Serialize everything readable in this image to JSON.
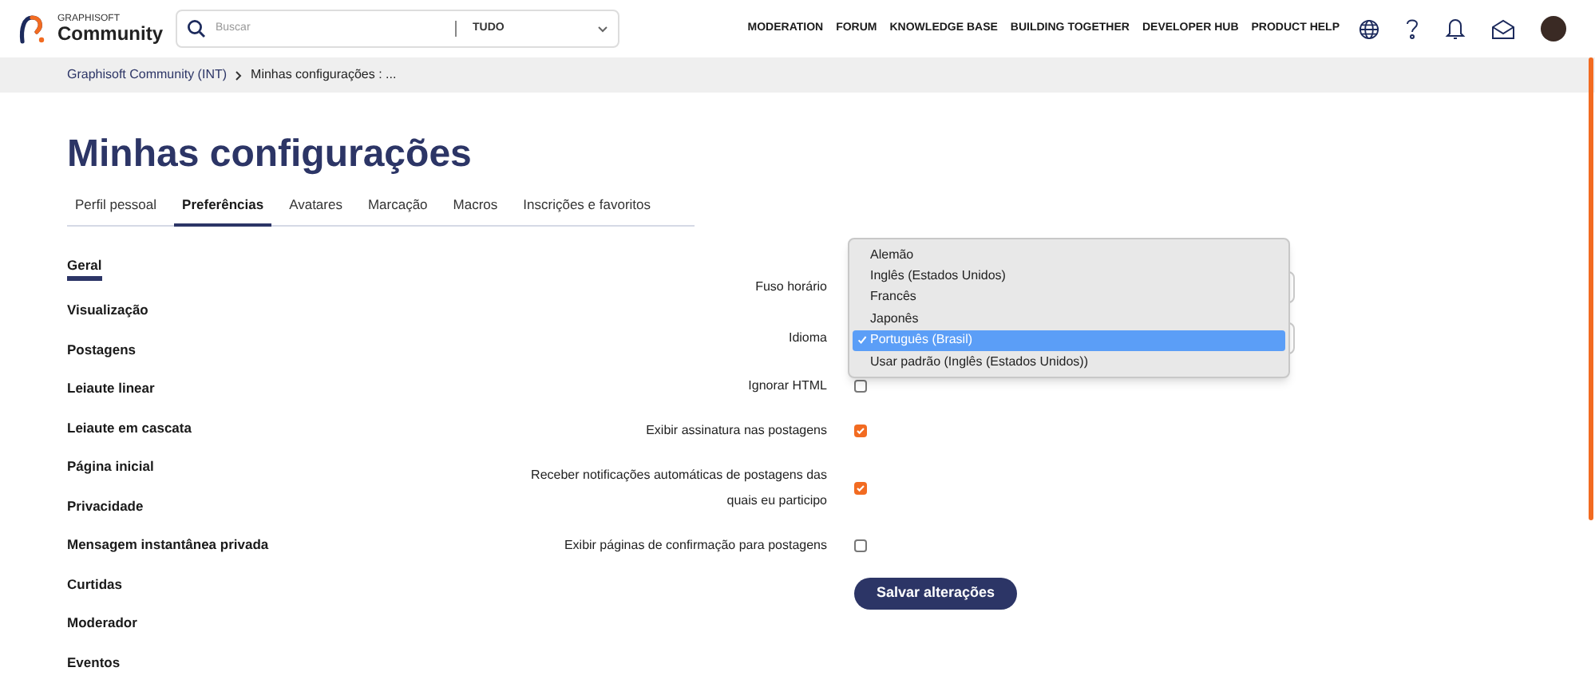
{
  "header": {
    "logo_small": "GRAPHISOFT",
    "logo_big": "Community",
    "search": {
      "placeholder": "Buscar",
      "scope": "TUDO"
    },
    "nav": [
      "MODERATION",
      "FORUM",
      "KNOWLEDGE BASE",
      "BUILDING TOGETHER",
      "DEVELOPER HUB",
      "PRODUCT HELP"
    ]
  },
  "breadcrumb": [
    "Graphisoft Community (INT)",
    "Minhas configurações : ..."
  ],
  "title": "Minhas configurações",
  "tabs": [
    {
      "label": "Perfil pessoal",
      "selected": false
    },
    {
      "label": "Preferências",
      "selected": true
    },
    {
      "label": "Avatares",
      "selected": false
    },
    {
      "label": "Marcação",
      "selected": false
    },
    {
      "label": "Macros",
      "selected": false
    },
    {
      "label": "Inscrições e favoritos",
      "selected": false
    }
  ],
  "sidebar": {
    "items": [
      {
        "label": "Geral",
        "selected": true
      },
      {
        "label": "Visualização",
        "selected": false
      },
      {
        "label": "Postagens",
        "selected": false
      },
      {
        "label": "Leiaute linear",
        "selected": false
      },
      {
        "label": "Leiaute em cascata",
        "selected": false
      },
      {
        "label": "Página inicial",
        "selected": false
      },
      {
        "label": "Privacidade",
        "selected": false
      },
      {
        "label": "Mensagem instantânea privada",
        "selected": false
      },
      {
        "label": "Curtidas",
        "selected": false
      },
      {
        "label": "Moderador",
        "selected": false
      },
      {
        "label": "Eventos",
        "selected": false
      }
    ]
  },
  "settings": [
    {
      "kind": "select",
      "label": "Fuso horário"
    },
    {
      "kind": "select",
      "label": "Idioma"
    },
    {
      "kind": "checkbox",
      "label": "Ignorar HTML",
      "checked": false
    },
    {
      "kind": "checkbox",
      "label": "Exibir assinatura nas postagens",
      "checked": true
    },
    {
      "kind": "checkbox",
      "label": "Receber notificações automáticas de postagens das quais eu participo",
      "checked": true
    },
    {
      "kind": "checkbox",
      "label": "Exibir páginas de confirmação para postagens",
      "checked": false
    }
  ],
  "dropdown": {
    "options": [
      {
        "label": "Alemão",
        "selected": false
      },
      {
        "label": "Inglês (Estados Unidos)",
        "selected": false
      },
      {
        "label": "Francês",
        "selected": false
      },
      {
        "label": "Japonês",
        "selected": false
      },
      {
        "label": "Português (Brasil)",
        "selected": true
      },
      {
        "label": "Usar padrão (Inglês (Estados Unidos))",
        "selected": false
      }
    ]
  },
  "save_button": "Salvar alterações"
}
